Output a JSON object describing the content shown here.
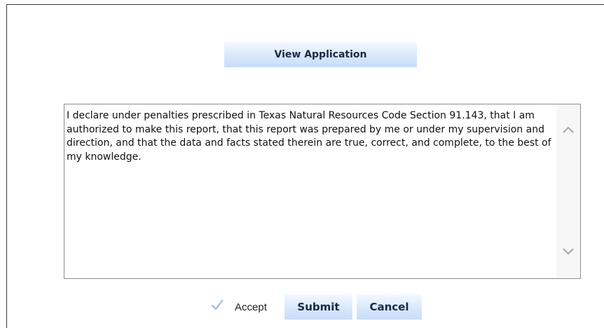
{
  "header": {
    "view_application_label": "View Application"
  },
  "declaration": {
    "text": "I declare under penalties prescribed in Texas Natural Resources Code Section 91.143, that I am authorized to make this report, that this report was prepared by me or under my supervision and direction, and that the data and facts stated therein are true, correct, and complete, to the best of my knowledge."
  },
  "footer": {
    "accept_label": "Accept",
    "accept_checked": true,
    "submit_label": "Submit",
    "cancel_label": "Cancel"
  },
  "colors": {
    "button_top": "#f4f8ff",
    "button_bottom": "#c9ddf8",
    "button_text": "#1a2a44",
    "check_mark": "#a9c3dd"
  },
  "icons": {
    "scroll_up": "chevron-up-icon",
    "scroll_down": "chevron-down-icon",
    "accept": "check-icon"
  }
}
